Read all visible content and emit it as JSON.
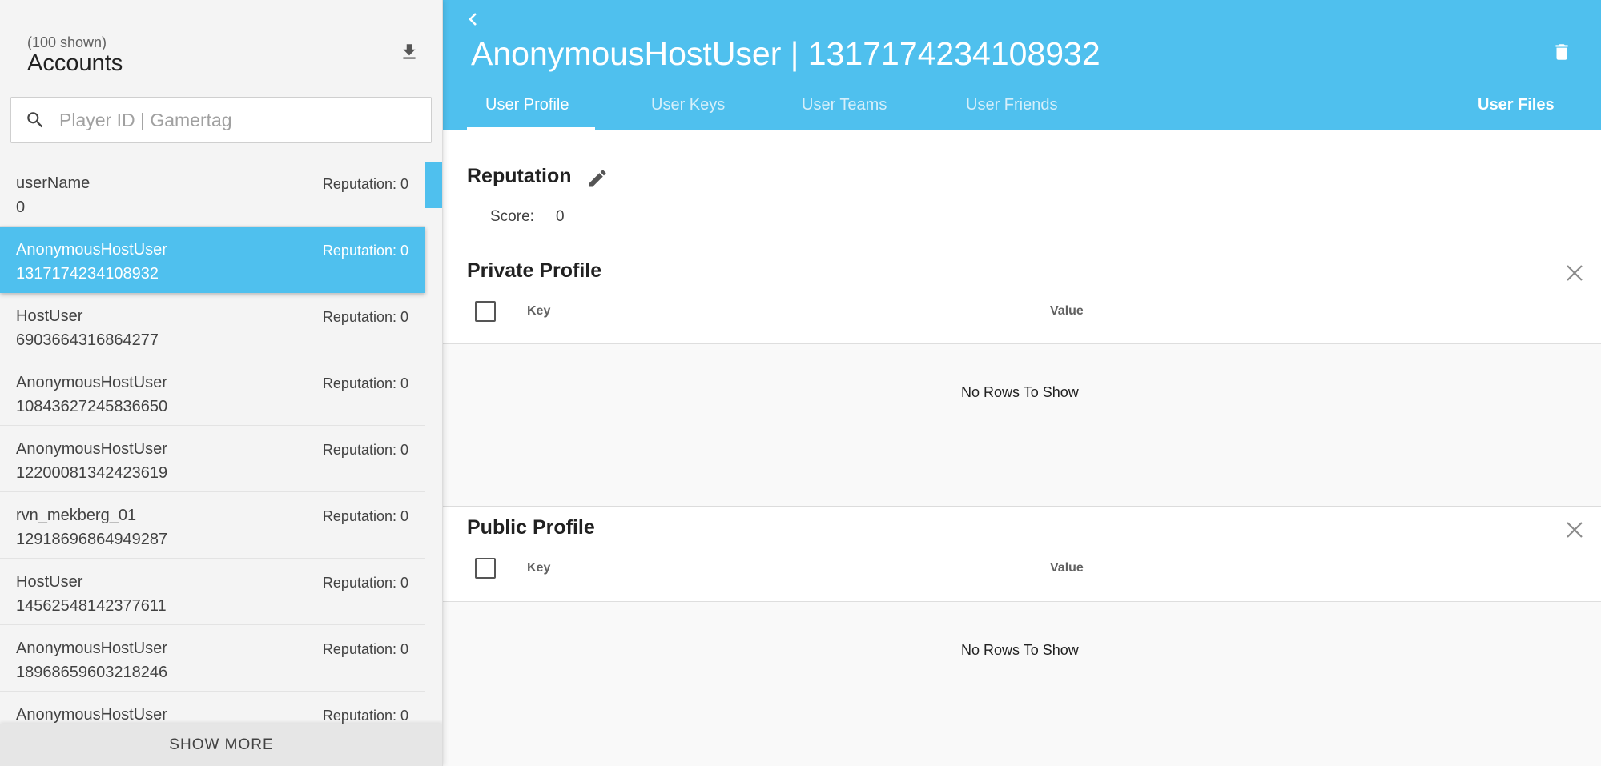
{
  "sidebar": {
    "count_label": "(100 shown)",
    "title": "Accounts",
    "search_placeholder": "Player ID | Gamertag",
    "show_more_label": "SHOW MORE",
    "items": [
      {
        "name": "userName",
        "reputation": "Reputation: 0",
        "id": "0",
        "selected": false
      },
      {
        "name": "AnonymousHostUser",
        "reputation": "Reputation: 0",
        "id": "1317174234108932",
        "selected": true
      },
      {
        "name": "HostUser",
        "reputation": "Reputation: 0",
        "id": "6903664316864277",
        "selected": false
      },
      {
        "name": "AnonymousHostUser",
        "reputation": "Reputation: 0",
        "id": "10843627245836650",
        "selected": false
      },
      {
        "name": "AnonymousHostUser",
        "reputation": "Reputation: 0",
        "id": "12200081342423619",
        "selected": false
      },
      {
        "name": "rvn_mekberg_01",
        "reputation": "Reputation: 0",
        "id": "12918696864949287",
        "selected": false
      },
      {
        "name": "HostUser",
        "reputation": "Reputation: 0",
        "id": "14562548142377611",
        "selected": false
      },
      {
        "name": "AnonymousHostUser",
        "reputation": "Reputation: 0",
        "id": "18968659603218246",
        "selected": false
      },
      {
        "name": "AnonymousHostUser",
        "reputation": "Reputation: 0",
        "id": "",
        "selected": false
      }
    ]
  },
  "header": {
    "title": "AnonymousHostUser | 1317174234108932",
    "tabs": [
      {
        "label": "User Profile",
        "active": true
      },
      {
        "label": "User Keys",
        "active": false
      },
      {
        "label": "User Teams",
        "active": false
      },
      {
        "label": "User Friends",
        "active": false
      }
    ],
    "files_tab": "User Files"
  },
  "reputation": {
    "title": "Reputation",
    "score_label": "Score:",
    "score_value": "0"
  },
  "private_profile": {
    "title": "Private Profile",
    "col_key": "Key",
    "col_value": "Value",
    "empty_text": "No Rows To Show"
  },
  "public_profile": {
    "title": "Public Profile",
    "col_key": "Key",
    "col_value": "Value",
    "empty_text": "No Rows To Show"
  },
  "colors": {
    "accent": "#4fc0ee",
    "sidebar_bg": "#f4f4f4"
  }
}
